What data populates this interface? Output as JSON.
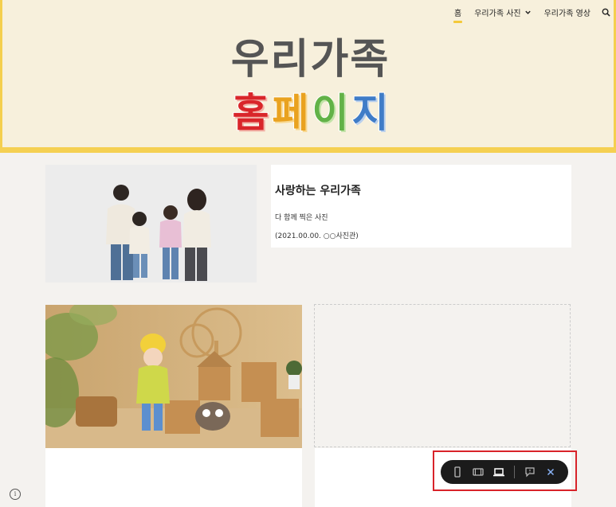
{
  "nav": {
    "items": [
      "홈",
      "우리가족 사진",
      "우리가족 영상"
    ],
    "active": "홈"
  },
  "header": {
    "title_line1": "우리가족",
    "title_line2_chars": [
      "홈",
      "페",
      "이",
      "지"
    ]
  },
  "card": {
    "title": "사랑하는 우리가족",
    "line1": "다 함께 찍은 사진",
    "line2": "(2021.00.00. ○○사진관)"
  },
  "info_icon_glyph": "i",
  "toolbar": {
    "buttons": [
      "phone-preview",
      "tablet-preview",
      "laptop-preview",
      "feedback",
      "close"
    ],
    "active": "laptop-preview"
  },
  "colors": {
    "header_bg": "#f7f0dc",
    "accent_yellow": "#f5d052",
    "title_red": "#d9262a",
    "title_orange": "#e9a21f",
    "title_green": "#62b247",
    "title_blue": "#3f7cc7",
    "highlight_red": "#d8232a",
    "toolbar_bg": "#1b1b1b",
    "close_blue": "#8ab4f8"
  }
}
